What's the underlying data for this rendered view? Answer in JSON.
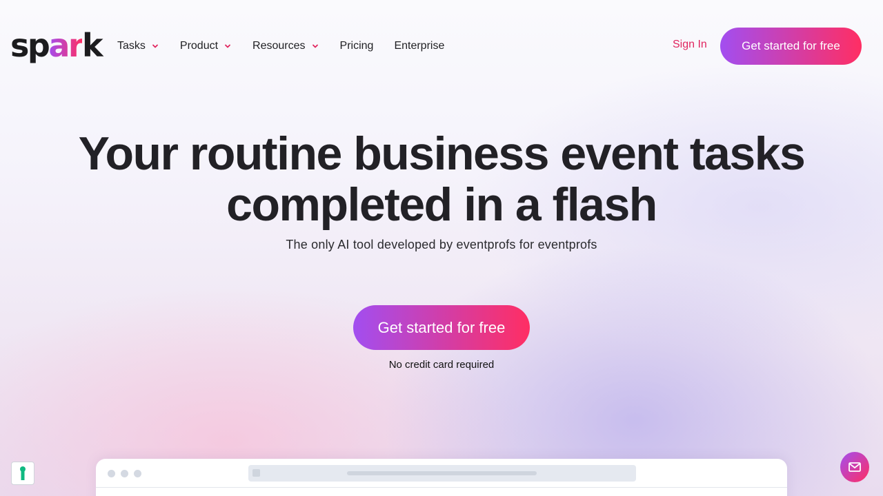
{
  "brand": {
    "logo_left": "sp",
    "logo_mid": "ar",
    "logo_right": "k",
    "accent_gradient": [
      "#a24ef0",
      "#ff2e63"
    ],
    "text_color": "#222126"
  },
  "nav": {
    "items": [
      {
        "label": "Tasks",
        "has_dropdown": true
      },
      {
        "label": "Product",
        "has_dropdown": true
      },
      {
        "label": "Resources",
        "has_dropdown": true
      },
      {
        "label": "Pricing",
        "has_dropdown": false
      },
      {
        "label": "Enterprise",
        "has_dropdown": false
      }
    ],
    "dropdown_icon": "chevron-down-icon",
    "sign_in_label": "Sign In",
    "sign_in_color": "#e0245e",
    "cta_label": "Get started for free"
  },
  "hero": {
    "title_line1": "Your routine business event tasks",
    "title_line2": "completed in a flash",
    "subtitle": "The only AI tool developed by eventprofs for eventprofs",
    "cta_label": "Get started for free",
    "cta_note": "No credit card required"
  },
  "preview": {
    "window_dots": 3,
    "dot_color": "#d4d9e2",
    "url_bar_color": "#e5e9f0"
  },
  "widgets": {
    "cookie_icon": "keyhole-icon",
    "cookie_icon_color": "#10b981",
    "chat_icon": "mail-icon"
  }
}
